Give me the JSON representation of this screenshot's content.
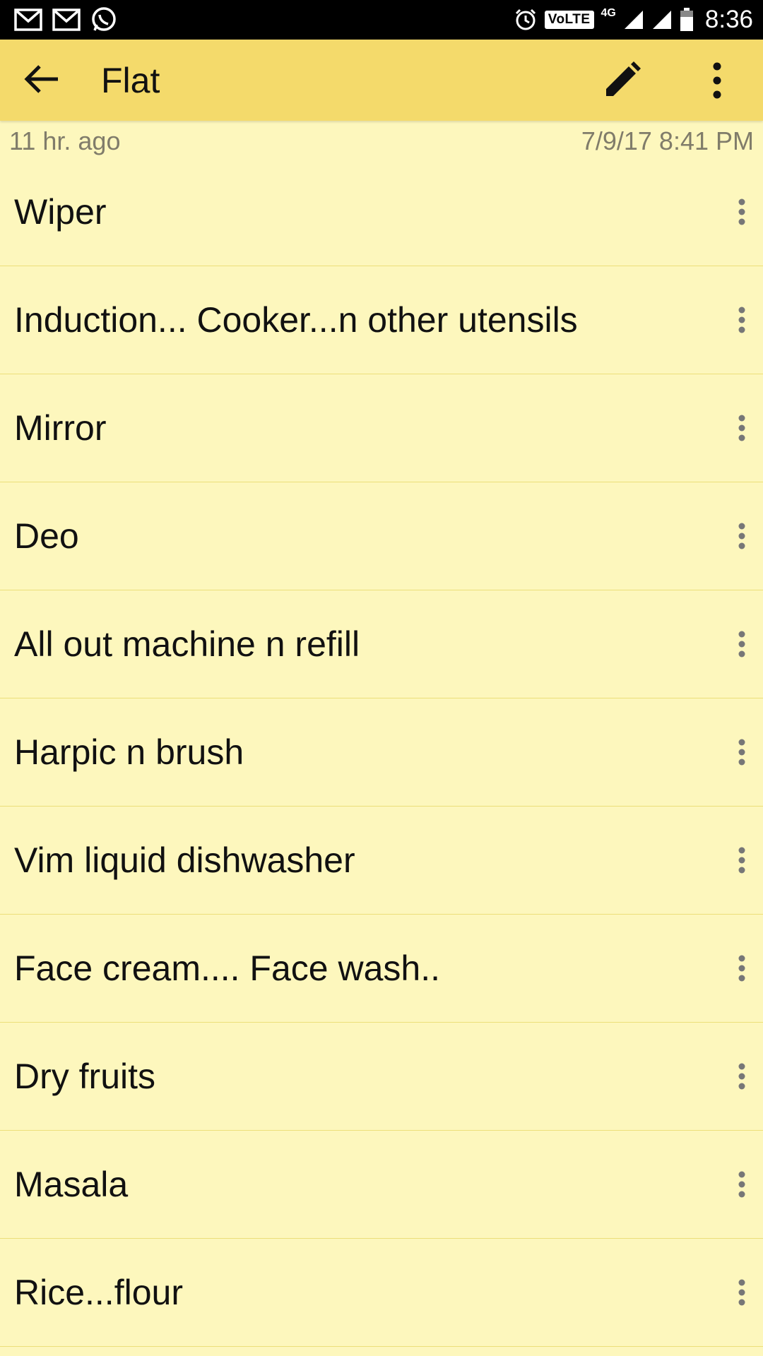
{
  "status_bar": {
    "time": "8:36",
    "volte_label": "VoLTE",
    "network_label": "4G",
    "left_icons": [
      "gmail-icon",
      "gmail-icon",
      "whatsapp-icon"
    ],
    "right_icons": [
      "alarm-icon",
      "volte-icon",
      "signal-icon",
      "signal-icon",
      "battery-icon"
    ]
  },
  "app_bar": {
    "title": "Flat",
    "back_icon": "arrow-left-icon",
    "edit_icon": "pencil-icon",
    "more_icon": "more-vertical-icon",
    "background": "#f4da6b"
  },
  "meta": {
    "relative_time": "11 hr. ago",
    "timestamp": "7/9/17 8:41 PM"
  },
  "items": [
    {
      "text": "Wiper"
    },
    {
      "text": "Induction... Cooker...n other utensils"
    },
    {
      "text": "Mirror"
    },
    {
      "text": "Deo"
    },
    {
      "text": "All out machine n refill"
    },
    {
      "text": "Harpic n brush"
    },
    {
      "text": "Vim liquid dishwasher"
    },
    {
      "text": "Face cream.... Face wash.."
    },
    {
      "text": "Dry fruits"
    },
    {
      "text": "Masala"
    },
    {
      "text": "Rice...flour"
    }
  ],
  "colors": {
    "page_background": "#fdf7bd",
    "divider": "#ecdf7a"
  }
}
